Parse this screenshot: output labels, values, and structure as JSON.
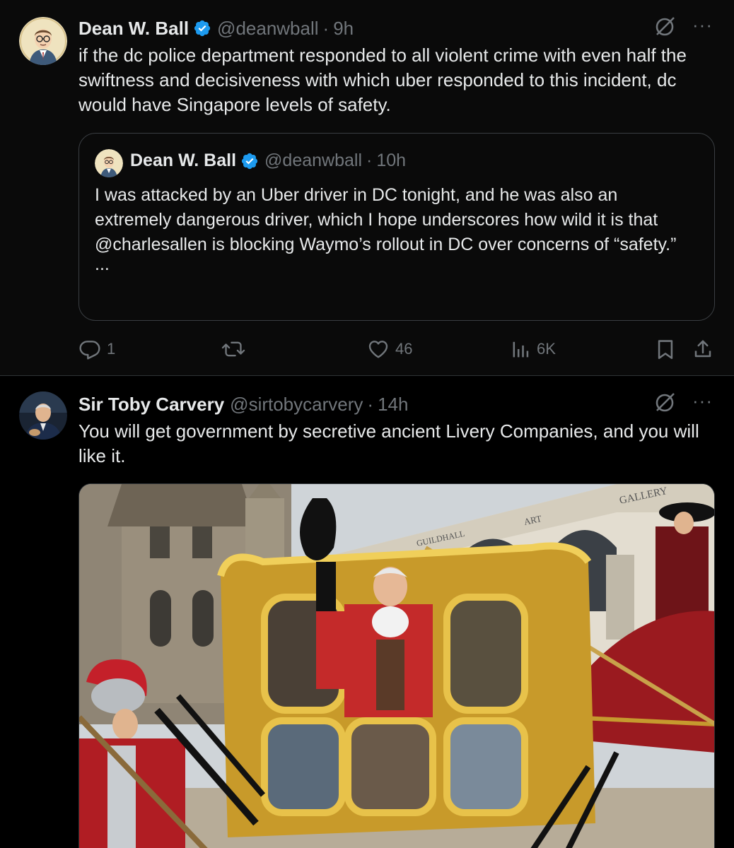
{
  "tweets": [
    {
      "author_name": "Dean W. Ball",
      "author_handle": "@deanwball",
      "dot": "·",
      "time": "9h",
      "text": "if the dc police department responded to all violent crime with even half the swiftness and decisiveness with which uber responded to this incident, dc would have Singapore levels of safety.",
      "more": "···",
      "quote": {
        "author_name": "Dean W. Ball",
        "author_handle": "@deanwball",
        "dot": "·",
        "time": "10h",
        "text": "I was attacked by an Uber driver in DC tonight, and he was also an extremely dangerous driver, which I hope underscores how wild it is that @charlesallen is blocking Waymo’s rollout in DC over concerns of “safety.”",
        "ellipsis": "..."
      },
      "actions": {
        "replies": "1",
        "reposts": "",
        "likes": "46",
        "views": "6K"
      }
    },
    {
      "author_name": "Sir Toby Carvery",
      "author_handle": "@sirtobycarvery",
      "dot": "·",
      "time": "14h",
      "text": "You will get government by secretive ancient Livery Companies, and you will like it.",
      "more": "···",
      "image_signs": {
        "gallery": "GALLERY",
        "art": "ART",
        "guildhall": "GUILDHALL"
      }
    }
  ],
  "colors": {
    "background": "#000000",
    "text": "#e7e9ea",
    "muted": "#71767b",
    "verified": "#1d9bf0",
    "border": "#2f3336"
  },
  "icons": [
    "verified-badge-icon",
    "grok-icon",
    "more-icon",
    "reply-icon",
    "repost-icon",
    "like-icon",
    "views-icon",
    "bookmark-icon",
    "share-icon"
  ]
}
